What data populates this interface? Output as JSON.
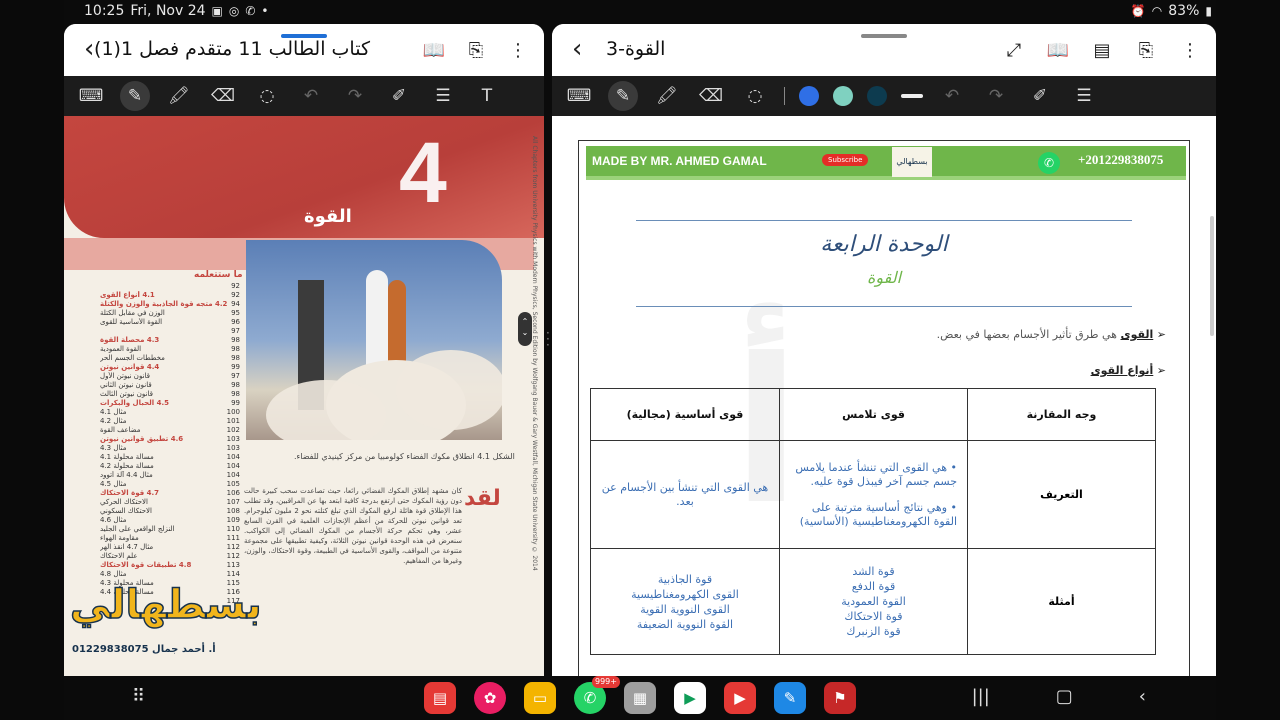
{
  "status_bar": {
    "time": "10:25",
    "date": "Fri, Nov 24",
    "battery": "83%"
  },
  "left_pane": {
    "title": "كتاب الطالب 11 متقدم فصل 1(1)",
    "document": {
      "chapter_number": "4",
      "chapter_title": "القوة",
      "toc_heading": "ما ستتعلمه",
      "toc": [
        {
          "page": "92",
          "text": ""
        },
        {
          "page": "92",
          "text": "4.1 أنواع القوى",
          "major": true
        },
        {
          "page": "94",
          "text": "4.2 متجه قوة الجاذبية والوزن والكتلة",
          "major": true
        },
        {
          "page": "95",
          "text": "الوزن في مقابل الكتلة"
        },
        {
          "page": "96",
          "text": "القوة الأساسية للقوى"
        },
        {
          "page": "97",
          "text": ""
        },
        {
          "page": "98",
          "text": "4.3 محصلة القوة",
          "major": true
        },
        {
          "page": "98",
          "text": "القوة العمودية"
        },
        {
          "page": "98",
          "text": "مخططات الجسم الحر"
        },
        {
          "page": "99",
          "text": "4.4 قوانين نيوتن",
          "major": true
        },
        {
          "page": "97",
          "text": "قانون نيوتن الأول"
        },
        {
          "page": "98",
          "text": "قانون نيوتن الثاني"
        },
        {
          "page": "98",
          "text": "قانون نيوتن الثالث"
        },
        {
          "page": "99",
          "text": "4.5 الحبال والبكرات",
          "major": true
        },
        {
          "page": "100",
          "text": "مثال 4.1"
        },
        {
          "page": "101",
          "text": "مثال 4.2"
        },
        {
          "page": "102",
          "text": "مضاعف القوة"
        },
        {
          "page": "103",
          "text": "4.6 تطبيق قوانين نيوتن",
          "major": true
        },
        {
          "page": "103",
          "text": "مثال 4.3"
        },
        {
          "page": "104",
          "text": "مسألة محلولة 4.1"
        },
        {
          "page": "104",
          "text": "مسألة محلولة 4.2"
        },
        {
          "page": "104",
          "text": "مثال 4.4 آلة أتوود"
        },
        {
          "page": "105",
          "text": "مثال 4.5"
        },
        {
          "page": "106",
          "text": "4.7 قوة الاحتكاك",
          "major": true
        },
        {
          "page": "107",
          "text": "الاحتكاك الحركي"
        },
        {
          "page": "108",
          "text": "الاحتكاك السكوني"
        },
        {
          "page": "109",
          "text": "مثال 4.6"
        },
        {
          "page": "110",
          "text": "النزلج الواقعي على الجليد"
        },
        {
          "page": "111",
          "text": "مقاومة الهواء"
        },
        {
          "page": "112",
          "text": "مثال 4.7 انقذ الهر"
        },
        {
          "page": "112",
          "text": "علم الاحتكاك"
        },
        {
          "page": "113",
          "text": "4.8 تطبيقات قوة الاحتكاك",
          "major": true
        },
        {
          "page": "114",
          "text": "مثال 4.8"
        },
        {
          "page": "115",
          "text": "مسألة محلولة 4.3"
        },
        {
          "page": "116",
          "text": "مسألة محلولة 4.4"
        },
        {
          "page": "117",
          "text": ""
        }
      ],
      "figure_caption": "الشكل 4.1 انطلاق مكوك الفضاء كولومبيا من مركز كينيدي للفضاء.",
      "intro_big_word": "لقد",
      "intro_text": "كان مشهد إطلاق المكوك الفضائي رائعا، حيث تصاعدت سحب كبيرة حالت دون رؤية المكوك حتى ارتفع بدرجة كافية ابتعد بها عن المراقبين، وقد تطلب هذا الإطلاق قوة هائلة لرفع المكوك الذي تبلغ كتلته نحو 2 مليون كيلوجرام. تعد قوانين نيوتن للحركة من أعظم الإنجازات العلمية في القرن السابع عشر، وهي تحكم حركة الأجسام من المكوك الفضائي إلى الكواكب. سنعرض في هذه الوحدة قوانين نيوتن الثلاثة، وكيفية تطبيقها على مجموعة متنوعة من المواقف، والقوى الأساسية في الطبيعة، وقوة الاحتكاك، والوزن، وغيرها من المفاهيم.",
      "side_strip": "All Chapters from University Physics with Modern Physics, Second Edition by Wolfgang Bauer & Gary Westfall, Michigan State University © 2014",
      "logo_text": "بسطهالي",
      "logo_sub": "أ. أحمد جمال 01229838075"
    }
  },
  "right_pane": {
    "title": "القوة-3",
    "document": {
      "banner": {
        "made_by": "MADE BY MR. AHMED GAMAL",
        "subscribe": "Subscribe",
        "logo_text": "بسطهالي",
        "phone": "+201229838075"
      },
      "unit_title": "الوحدة الرابعة",
      "unit_subtitle": "القوة",
      "bullets": [
        {
          "term": "القوى",
          "definition": "هي طرق تأثير الأجسام بعضها في بعض."
        },
        {
          "term": "أنواع القوى",
          "definition": ""
        }
      ],
      "table": {
        "headers": [
          "وجه المقارنة",
          "قوى تلامس",
          "قوى أساسية (مجالية)"
        ],
        "definition_label": "التعريف",
        "contact_def_1": "• هي القوى التي تنشأ عندما يلامس جسم جسم آخر فيبذل قوة عليه.",
        "contact_def_2": "• وهي نتائج أساسية مترتبة على القوة الكهرومغناطيسية (الأساسية)",
        "field_def": "هي القوى التي تنشأ بين الأجسام عن بعد.",
        "examples_label": "أمثلة",
        "contact_examples": [
          "قوة الشد",
          "قوة الدفع",
          "القوة العمودية",
          "قوة الاحتكاك",
          "قوة الزنبرك"
        ],
        "field_examples": [
          "قوة الجاذبية",
          "القوى الكهرومغناطيسية",
          "القوى النووية القوية",
          "القوة النووية الضعيفة"
        ]
      }
    }
  },
  "nav": {
    "badge": "999+"
  },
  "colors": {
    "toolbar": "#1c1c1c",
    "pen_blue": "#2f6fe6",
    "pen_teal": "#7fd1c0",
    "pen_navy": "#0d3b4f",
    "banner_green": "#6fb64a",
    "doc_blue": "#3b6eb3",
    "chapter_red": "#c4463f"
  }
}
